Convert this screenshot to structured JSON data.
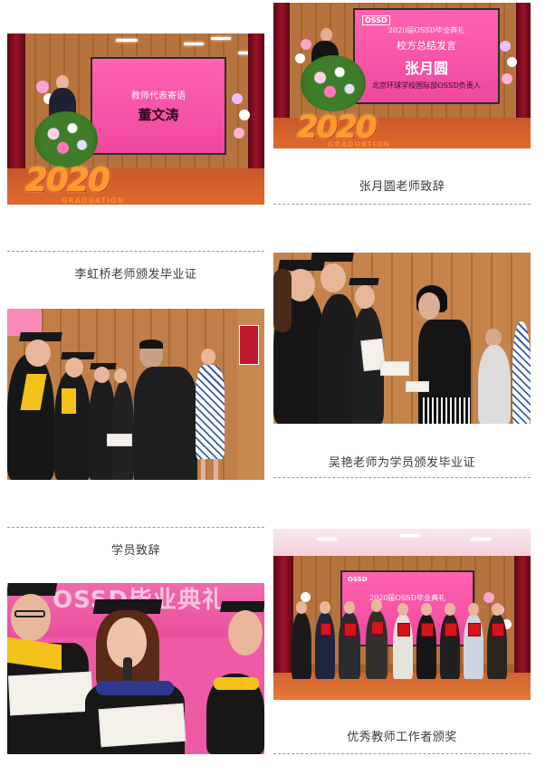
{
  "photos": {
    "p1": {
      "screen_title": "教师代表寄语",
      "screen_name": "董文涛",
      "banner": "2020",
      "banner_sub": "GRADUATION"
    },
    "p2": {
      "screen_header": "2020届OSSD毕业典礼",
      "screen_title": "校方总结发言",
      "screen_name": "张月圆",
      "screen_sub": "北京环球学校国际部OSSD负责人",
      "logo": "OSSD",
      "banner": "2020",
      "banner_sub": "GRADUATION"
    },
    "p6": {
      "screen_header": "OSSD毕业典礼",
      "screen_logo": "OSSD"
    },
    "p7": {
      "screen_header": "2020届OSSD毕业典礼",
      "logo": "OSSD"
    }
  },
  "captions": {
    "c1": "张月圆老师致辞",
    "c2": "李虹桥老师颁发毕业证",
    "c3": "吴艳老师为学员颁发毕业证",
    "c4": "学员致辞",
    "c5": "优秀教师工作者颁奖"
  },
  "colors": {
    "screen_pink": "#f0489f",
    "curtain": "#9d1229",
    "banner_orange": "#ff9b2e",
    "gown_black": "#161616",
    "hood_yellow": "#f2c21a"
  }
}
